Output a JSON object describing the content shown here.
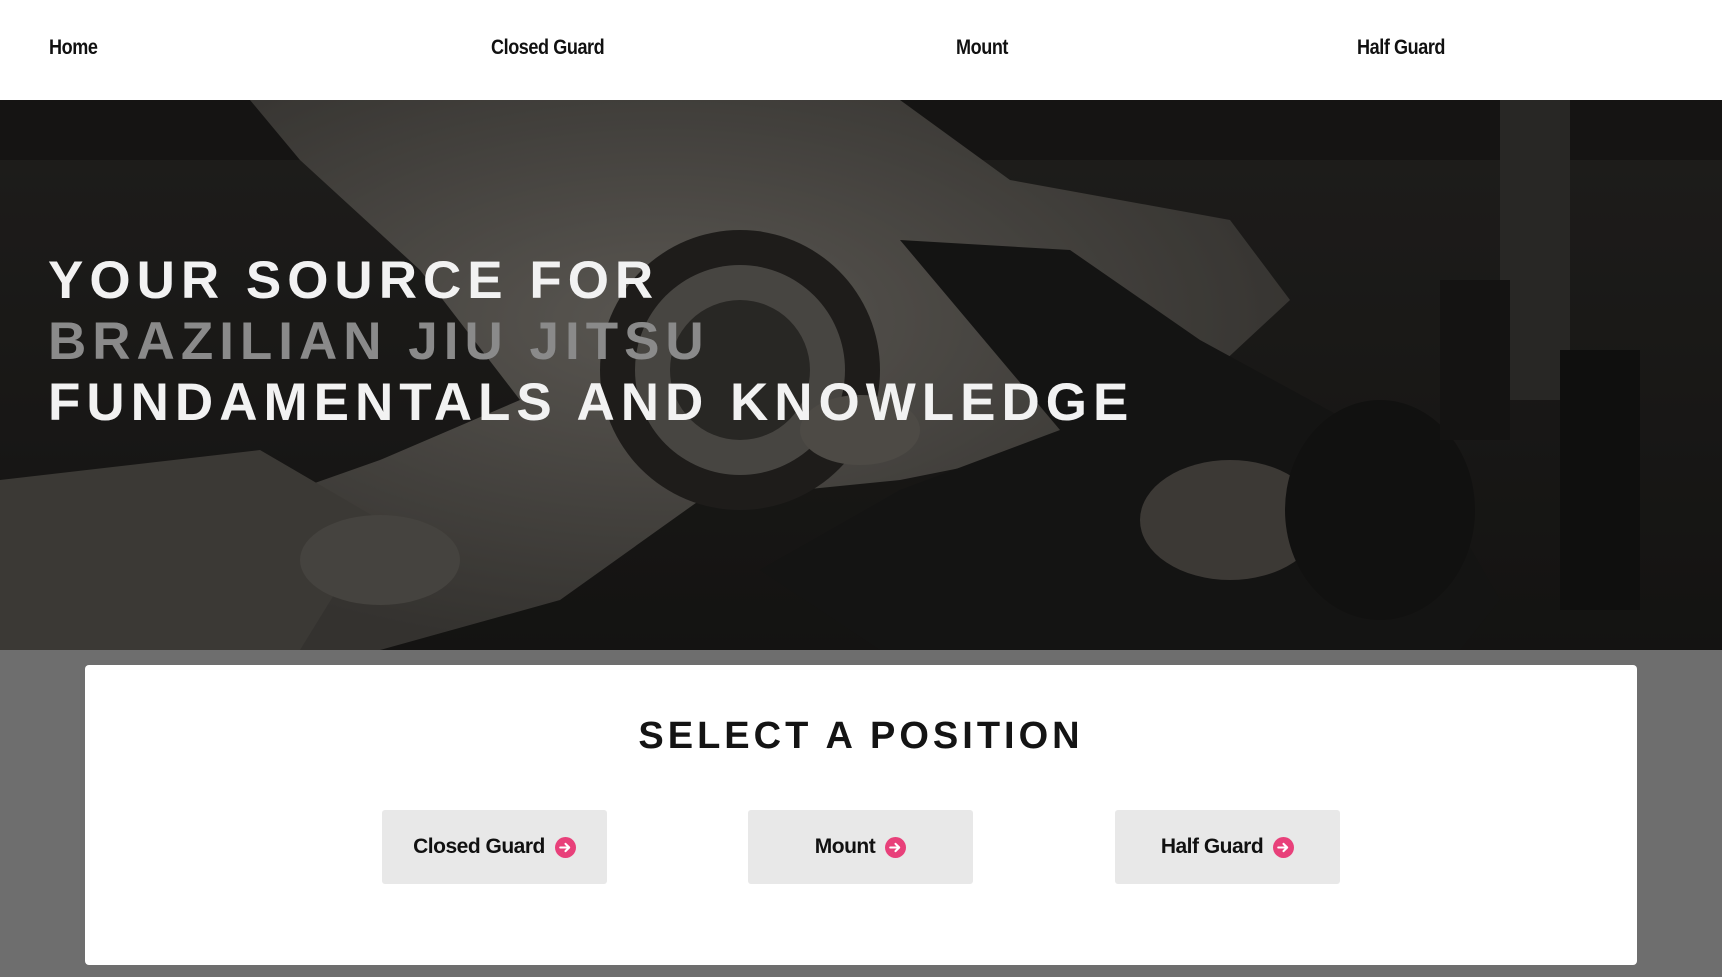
{
  "nav": {
    "items": [
      {
        "label": "Home"
      },
      {
        "label": "Closed Guard"
      },
      {
        "label": "Mount"
      },
      {
        "label": "Half Guard"
      }
    ]
  },
  "hero": {
    "line1": "YOUR SOURCE FOR",
    "line2": "BRAZILIAN JIU JITSU",
    "line3": "FUNDAMENTALS AND KNOWLEDGE"
  },
  "panel": {
    "title": "SELECT A POSITION",
    "buttons": [
      {
        "label": "Closed Guard",
        "icon": "arrow-right-circle-icon"
      },
      {
        "label": "Mount",
        "icon": "arrow-right-circle-icon"
      },
      {
        "label": "Half Guard",
        "icon": "arrow-right-circle-icon"
      }
    ]
  },
  "colors": {
    "accent": "#e8407a",
    "nav_bg": "#ffffff",
    "page_bg": "#6e6e6e",
    "button_bg": "#e8e8e8"
  }
}
